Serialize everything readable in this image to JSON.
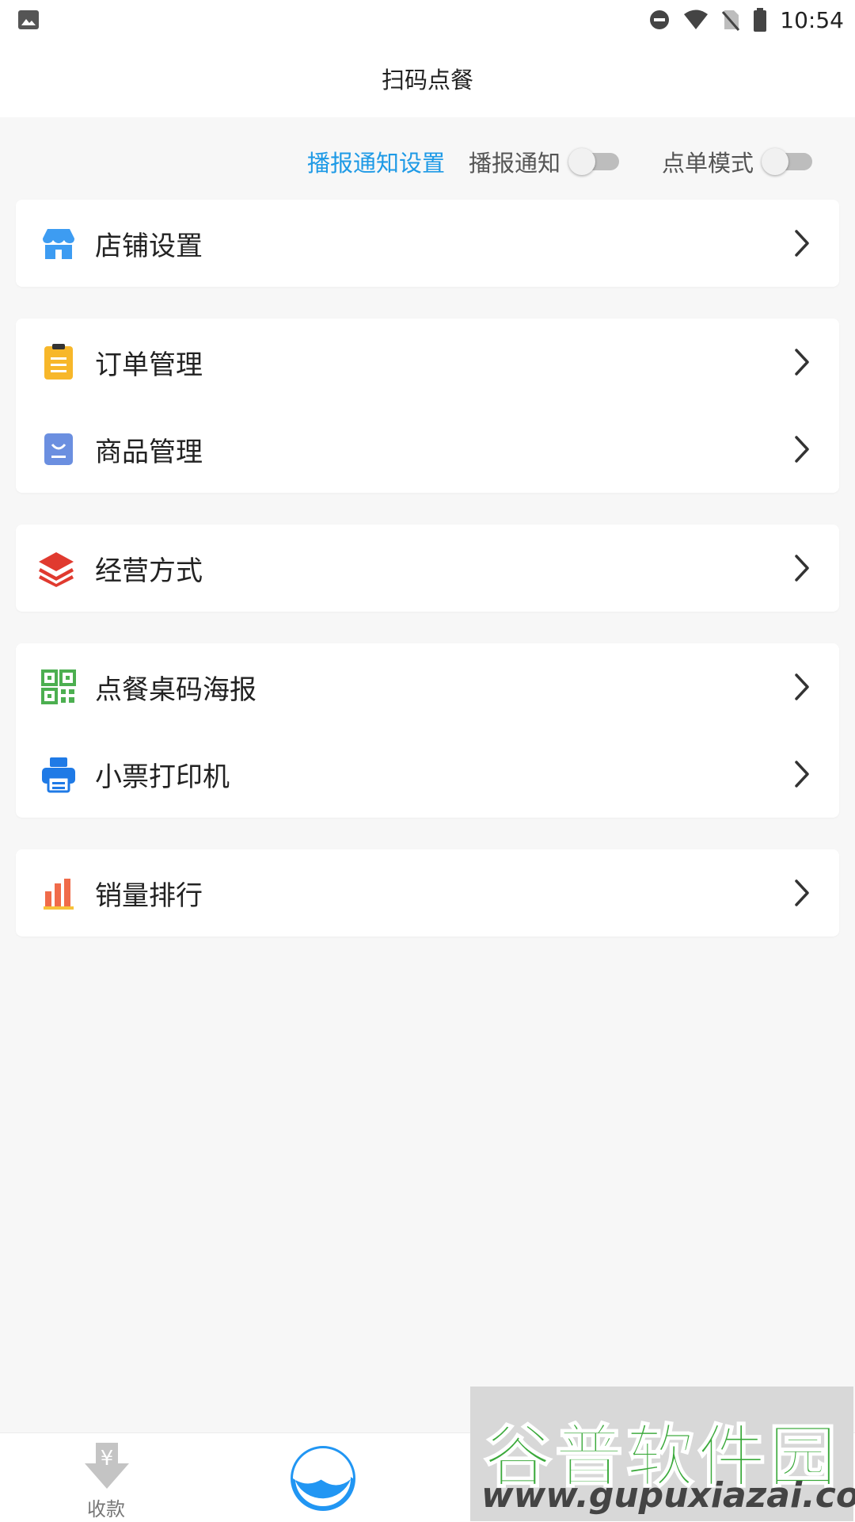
{
  "status_bar": {
    "time": "10:54"
  },
  "header": {
    "title": "扫码点餐"
  },
  "toggles": {
    "settings_link": "播报通知设置",
    "broadcast_label": "播报通知",
    "order_mode_label": "点单模式",
    "broadcast_on": false,
    "order_mode_on": false
  },
  "menu": {
    "store_settings": "店铺设置",
    "order_management": "订单管理",
    "product_management": "商品管理",
    "business_mode": "经营方式",
    "table_code_poster": "点餐桌码海报",
    "receipt_printer": "小票打印机",
    "sales_ranking": "销量排行"
  },
  "bottom_nav": {
    "collect_label": "收款"
  },
  "colors": {
    "accent": "#1e9ae6",
    "store_icon": "#3d9cf2",
    "order_icon": "#f7b72a",
    "product_icon": "#6b8fe0",
    "business_icon": "#e03a2f",
    "qr_icon": "#4caf50",
    "printer_icon": "#1f7ae6"
  },
  "watermark": {
    "title": "谷普软件园",
    "url": "www.gupuxiazai.com"
  }
}
